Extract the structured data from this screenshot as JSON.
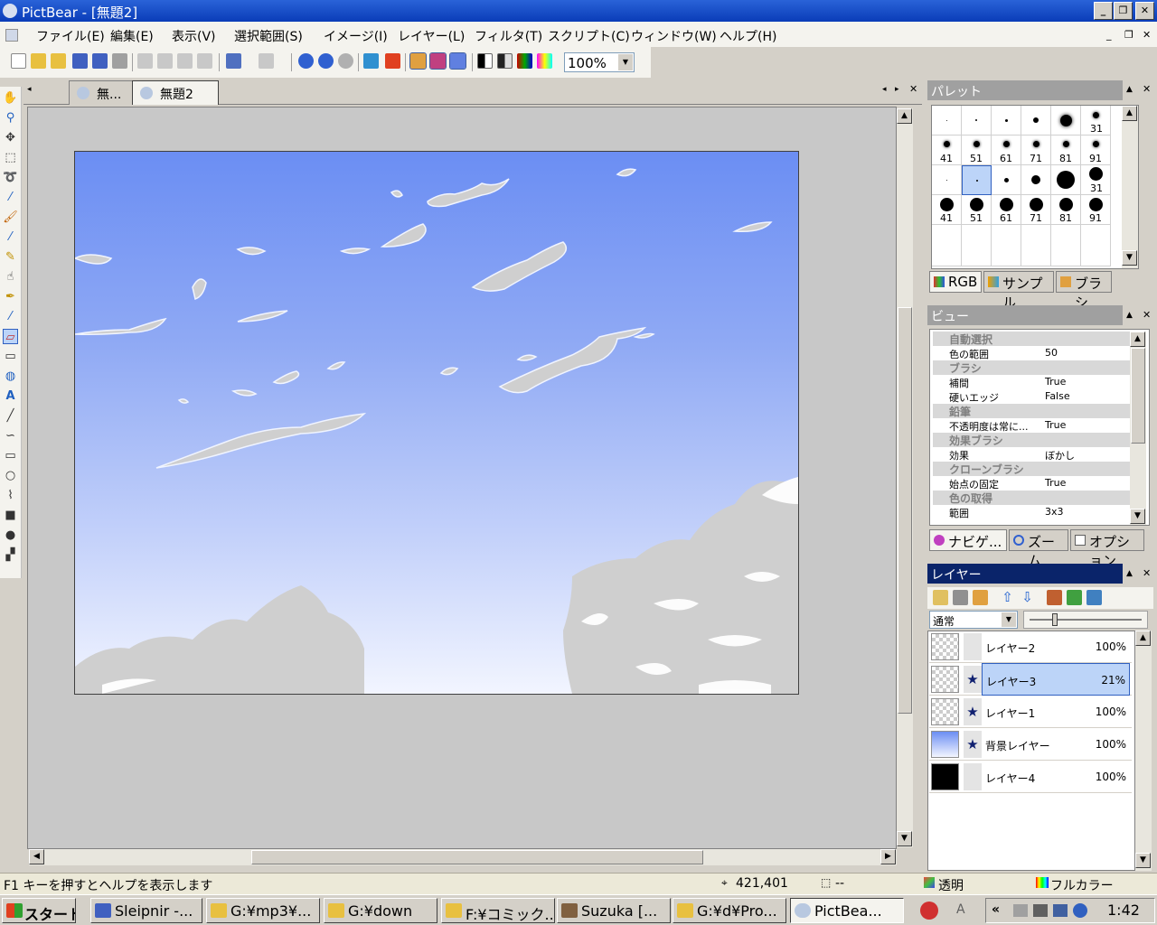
{
  "window": {
    "title": "PictBear - [無題2]"
  },
  "menu": [
    "ファイル(E)",
    "編集(E)",
    "表示(V)",
    "選択範囲(S)",
    "イメージ(I)",
    "レイヤー(L)",
    "フィルタ(T)",
    "スクリプト(C)",
    "ウィンドウ(W)",
    "ヘルプ(H)"
  ],
  "toolbar": {
    "zoom": "100%"
  },
  "documents": {
    "tab1": "無...",
    "tab2": "無題2"
  },
  "palette": {
    "title": "パレット",
    "tabs": [
      "RGB",
      "サンプル",
      "ブラシ"
    ],
    "brush_labels": [
      "31",
      "41",
      "51",
      "61",
      "71",
      "81",
      "91",
      "31",
      "41",
      "51",
      "61",
      "71",
      "81",
      "91"
    ]
  },
  "view_panel": {
    "title": "ビュー",
    "cat_auto": "自動選択",
    "k_range": "色の範囲",
    "v_range": "50",
    "cat_brush": "ブラシ",
    "k_interp": "補間",
    "v_interp": "True",
    "k_hard": "硬いエッジ",
    "v_hard": "False",
    "cat_pencil": "鉛筆",
    "k_opacity": "不透明度は常に...",
    "v_opacity": "True",
    "cat_effect": "効果ブラシ",
    "k_effect": "効果",
    "v_effect": "ぼかし",
    "cat_clone": "クローンブラシ",
    "k_fix": "始点の固定",
    "v_fix": "True",
    "cat_pick": "色の取得",
    "k_pickrange": "範囲",
    "v_pickrange": "3x3",
    "tabs": [
      "ナビゲ...",
      "ズーム",
      "オプション"
    ]
  },
  "layers": {
    "title": "レイヤー",
    "blend_mode": "通常",
    "items": [
      {
        "name": "レイヤー2",
        "opacity": "100%"
      },
      {
        "name": "レイヤー3",
        "opacity": "21%"
      },
      {
        "name": "レイヤー1",
        "opacity": "100%"
      },
      {
        "name": "背景レイヤー",
        "opacity": "100%"
      },
      {
        "name": "レイヤー4",
        "opacity": "100%"
      }
    ]
  },
  "status": {
    "help": "F1 キーを押すとヘルプを表示します",
    "coords": "421,401",
    "size": "--",
    "transparency": "透明",
    "colormode": "フルカラー"
  },
  "taskbar": {
    "start": "スタート",
    "buttons": [
      "Sleipnir -...",
      "G:¥mp3¥...",
      "G:¥down",
      "F:¥コミック...",
      "Suzuka [...",
      "G:¥d¥Pro...",
      "PictBea..."
    ],
    "clock": "1:42"
  },
  "colors": {
    "titlebar": "#0a3cb8",
    "panel_title": "#a0a0a0",
    "active_layer": "#bcd4f8"
  }
}
